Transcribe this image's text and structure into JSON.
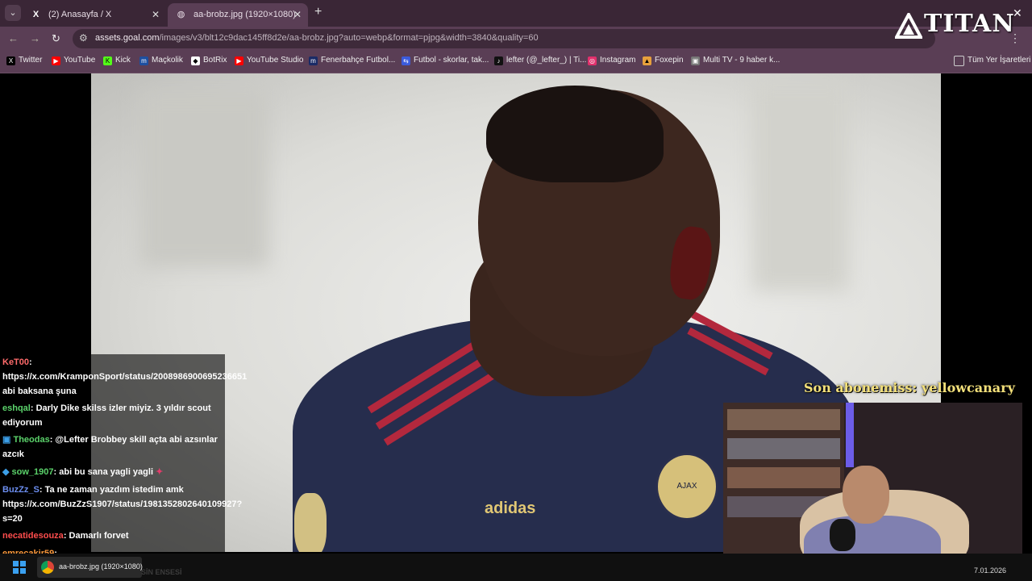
{
  "tabs": [
    {
      "title": "(2) Anasayfa / X",
      "icon": "X"
    },
    {
      "title": "aa-brobz.jpg (1920×1080)",
      "icon": "globe"
    }
  ],
  "url": {
    "host": "assets.goal.com",
    "path": "/images/v3/blt12c9dac145ff8d2e/aa-brobz.jpg?auto=webp&format=pjpg&width=3840&quality=60"
  },
  "bookmarks": [
    {
      "label": "Twitter",
      "color": "#000000"
    },
    {
      "label": "YouTube",
      "color": "#ff0000"
    },
    {
      "label": "Kick",
      "color": "#53fc18"
    },
    {
      "label": "Maçkolik",
      "color": "#1d4fa0"
    },
    {
      "label": "BotRix",
      "color": "#ffffff"
    },
    {
      "label": "YouTube Studio",
      "color": "#ff0000"
    },
    {
      "label": "Fenerbahçe Futbol...",
      "color": "#1a2b66"
    },
    {
      "label": "Futbol - skorlar, tak...",
      "color": "#3b5bdb"
    },
    {
      "label": "lefter (@_lefter_) | Ti...",
      "color": "#111111"
    },
    {
      "label": "Instagram",
      "color": "#e1306c"
    },
    {
      "label": "Foxepin",
      "color": "#e7a03c"
    },
    {
      "label": "Multi TV - 9 haber k...",
      "color": "#999999"
    }
  ],
  "all_bookmarks": "Tüm Yer İşaretleri",
  "chat": [
    {
      "user": "KeT00",
      "color": "#ff6b6b",
      "text": ": https://x.com/KramponSport/status/2008986900695236651 abi baksana şuna"
    },
    {
      "user": "eshqal",
      "color": "#5bd36b",
      "text": ": Darly Dike skilss izler miyiz. 3 yıldır scout ediyorum"
    },
    {
      "user": "Theodas",
      "color": "#5bd36b",
      "text": ": @Lefter Brobbey skill açta abi azsınlar azcık"
    },
    {
      "user": "sow_1907",
      "color": "#5bd36b",
      "text": ": abi bu sana yagli yagli"
    },
    {
      "user": "BuzZz_S",
      "color": "#6c8ef0",
      "text": ": Ta ne zaman yazdım istedim amk https://x.com/BuzZzS1907/status/1981352802640109927?s=20"
    },
    {
      "user": "necatidesouza",
      "color": "#ff4d4d",
      "text": ": Damarlı forvet"
    },
    {
      "user": "emrecakir59",
      "color": "#ff9a3c",
      "text": ":"
    }
  ],
  "overlay": {
    "sub_banner": "Son abonemiss: yellowcanary",
    "logo": "TITAN"
  },
  "photo": {
    "kit_text": "adidas",
    "crest": "AJAX"
  },
  "taskbar": {
    "app_label": "aa-brobz.jpg (1920×1080)",
    "faint": "SİN ENSESİ",
    "date": "7.01.2026"
  }
}
